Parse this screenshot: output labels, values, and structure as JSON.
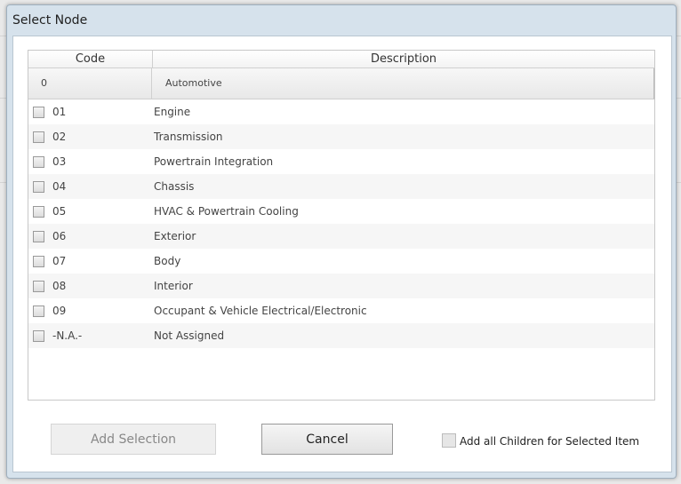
{
  "dialog": {
    "title": "Select Node"
  },
  "grid": {
    "headers": {
      "code": "Code",
      "description": "Description"
    },
    "root": {
      "code": "0",
      "description": "Automotive"
    },
    "rows": [
      {
        "code": "01",
        "description": "Engine"
      },
      {
        "code": "02",
        "description": "Transmission"
      },
      {
        "code": "03",
        "description": "Powertrain Integration"
      },
      {
        "code": "04",
        "description": "Chassis"
      },
      {
        "code": "05",
        "description": "HVAC & Powertrain Cooling"
      },
      {
        "code": "06",
        "description": "Exterior"
      },
      {
        "code": "07",
        "description": "Body"
      },
      {
        "code": "08",
        "description": "Interior"
      },
      {
        "code": "09",
        "description": "Occupant & Vehicle Electrical/Electronic"
      },
      {
        "code": "-N.A.-",
        "description": "Not Assigned"
      }
    ]
  },
  "footer": {
    "add_label": "Add Selection",
    "cancel_label": "Cancel",
    "children_label": "Add all Children for Selected Item"
  }
}
